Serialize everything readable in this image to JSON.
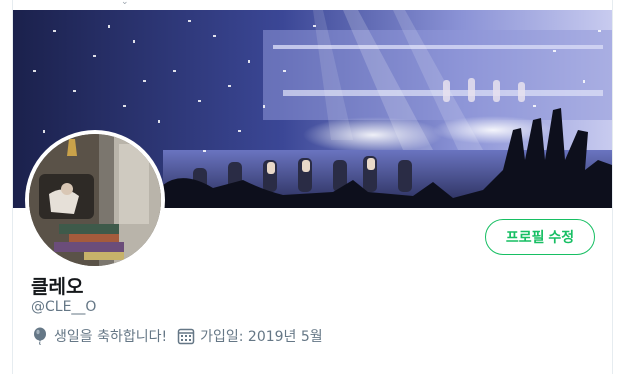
{
  "profile": {
    "display_name": "클레오",
    "handle": "@CLE__O",
    "edit_profile_label": "프로필 수정",
    "birthday_text": "생일을 축하합니다!",
    "joined_text": "가입일: 2019년 5월"
  },
  "icons": {
    "birthday": "balloon-icon",
    "joined": "calendar-icon"
  },
  "colors": {
    "accent": "#17bf63",
    "secondary_text": "#657786",
    "primary_text": "#14171a"
  }
}
